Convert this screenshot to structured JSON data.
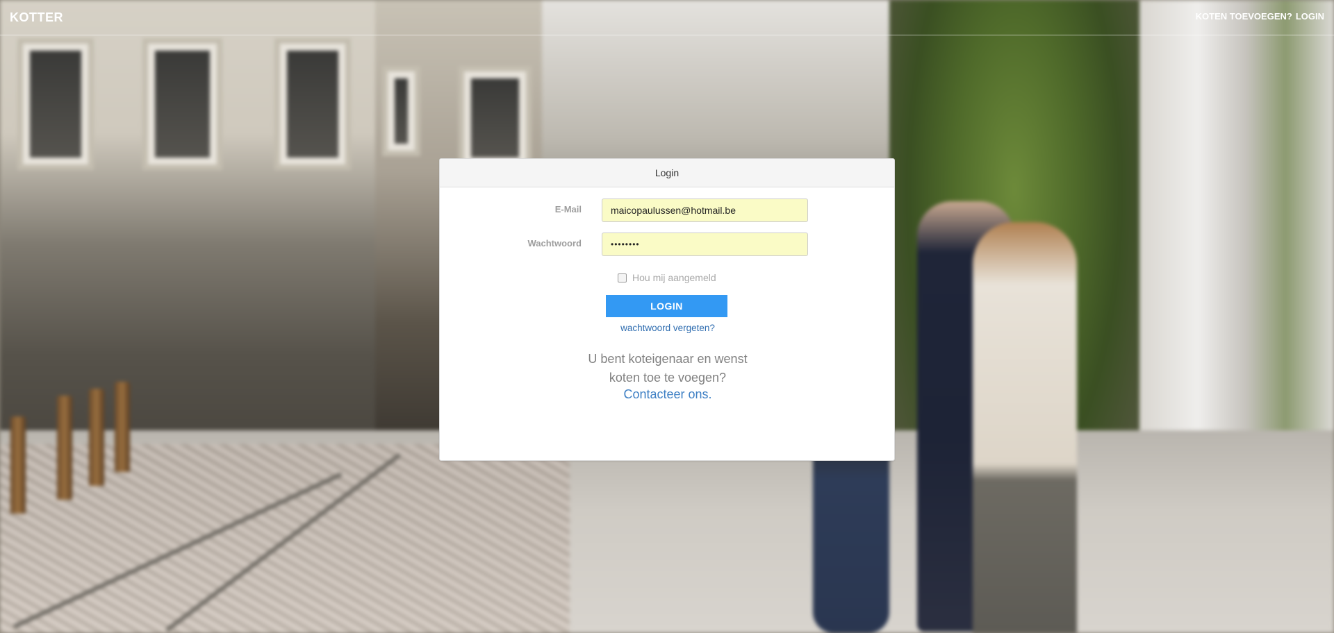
{
  "header": {
    "brand": "KOTTER",
    "nav": {
      "add_rooms": "KOTEN TOEVOEGEN?",
      "login": "LOGIN"
    }
  },
  "login_panel": {
    "title": "Login",
    "email_label": "E-Mail",
    "email_value": "maicopaulussen@hotmail.be",
    "password_label": "Wachtwoord",
    "password_value": "••••••••",
    "remember_label": "Hou mij aangemeld",
    "remember_checked": false,
    "submit_label": "LOGIN",
    "forgot_link": "wachtwoord vergeten?",
    "owner_text_line1": "U bent koteigenaar en wenst",
    "owner_text_line2": "koten toe te voegen?",
    "contact_link": "Contacteer ons."
  },
  "colors": {
    "primary_button": "#3399f3",
    "link": "#2f6db0",
    "input_autofill": "#fafbc6"
  }
}
